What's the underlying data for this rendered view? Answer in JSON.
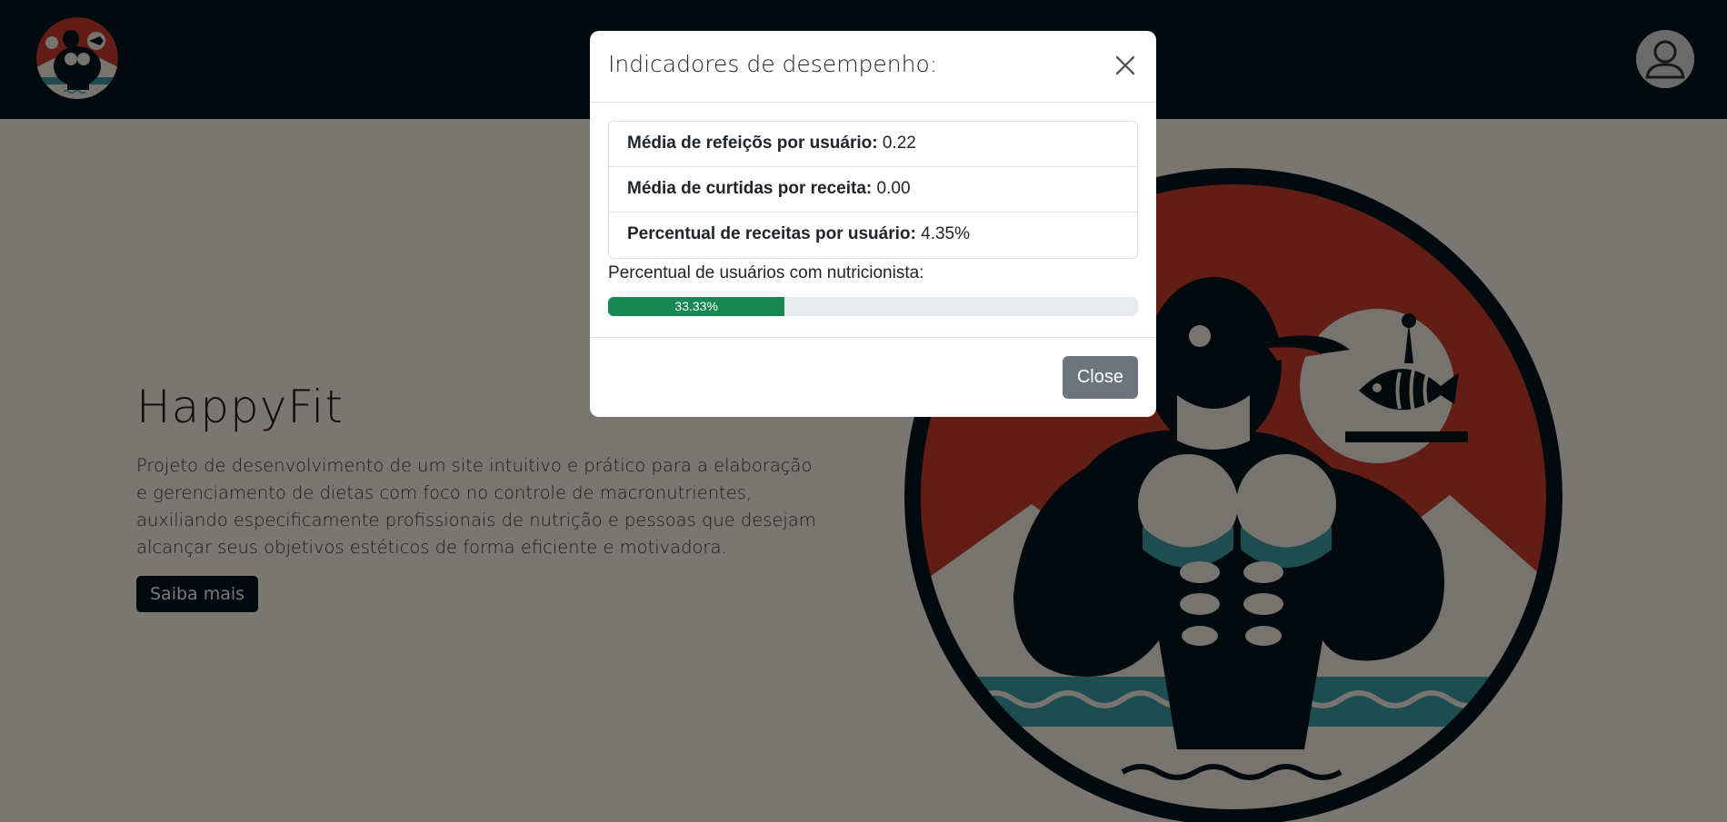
{
  "header": {
    "logo_icon": "penguin-bodybuilder-logo",
    "avatar_icon": "user-avatar-icon",
    "background_color": "#04141c"
  },
  "hero": {
    "title": "HappyFit",
    "description": "Projeto de desenvolvimento de um site intuitivo e prático para a elaboração e gerenciamento de dietas com foco no controle de macronutrientes, auxiliando especificamente profissionais de nutrição e pessoas que desejam alcançar seus objetivos estéticos de forma eficiente e motivadora.",
    "button_label": "Saiba mais",
    "illustration_icon": "penguin-bodybuilder-illustration"
  },
  "modal": {
    "title": "Indicadores de desempenho:",
    "stats": [
      {
        "label": "Média de refeiçõs por usuário:",
        "value": "0.22"
      },
      {
        "label": "Média de curtidas por receita:",
        "value": "0.00"
      },
      {
        "label": "Percentual de receitas por usuário:",
        "value": "4.35%"
      }
    ],
    "progress": {
      "label": "Percentual de usuários com nutricionista:",
      "value_text": "33.33%",
      "percent": 33.33,
      "color": "#198754"
    },
    "close_button_label": "Close"
  },
  "colors": {
    "accent_red": "#c23b2c",
    "accent_teal": "#3b9aa0",
    "dark_navy": "#04141c",
    "cream": "#f4eee6",
    "secondary_button": "#6c757d"
  }
}
